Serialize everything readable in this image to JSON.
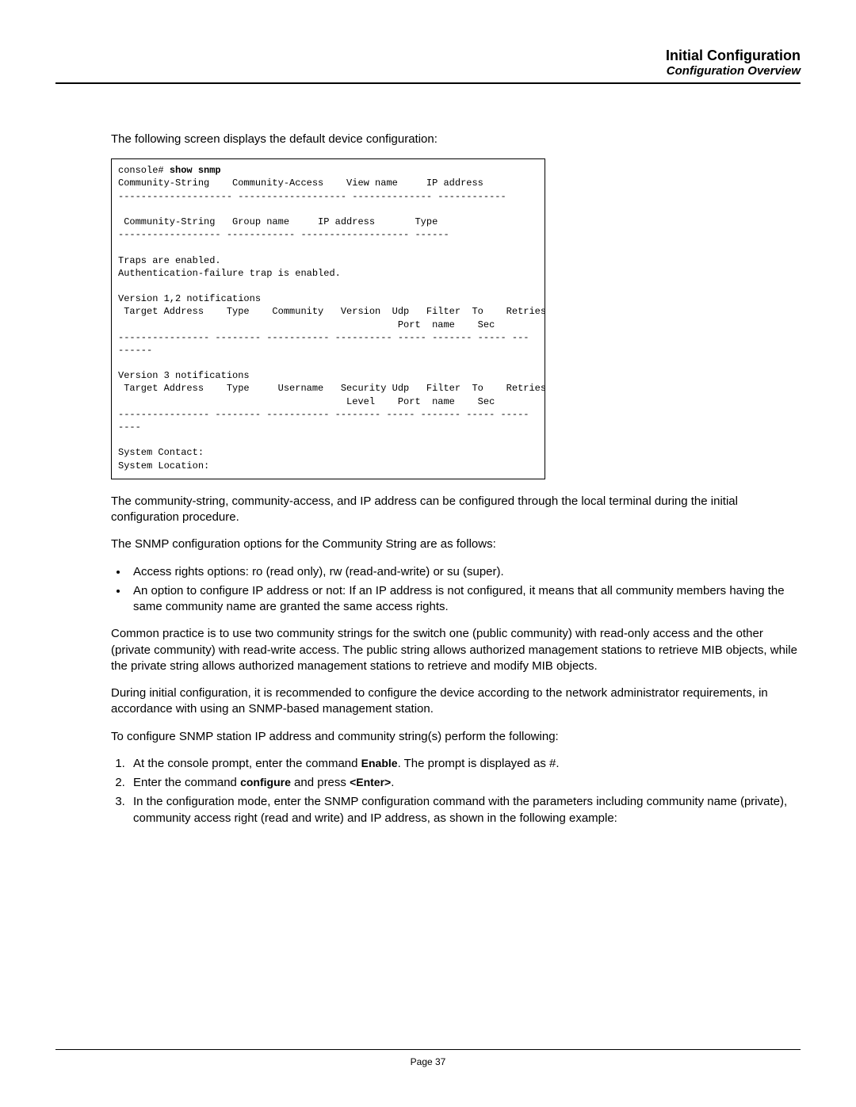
{
  "header": {
    "title": "Initial Configuration",
    "subtitle": "Configuration Overview"
  },
  "intro": "The following screen displays the default device configuration:",
  "terminal": {
    "prompt": "console# ",
    "command": "show snmp",
    "body": "\nCommunity-String    Community-Access    View name     IP address\n-------------------- ------------------- -------------- ------------\n\n Community-String   Group name     IP address       Type\n------------------ ------------ ------------------- ------\n\nTraps are enabled.\nAuthentication-failure trap is enabled.\n\nVersion 1,2 notifications\n Target Address    Type    Community   Version  Udp   Filter  To    Retries\n                                                 Port  name    Sec\n---------------- -------- ----------- ---------- ----- ------- ----- ---\n------\n\nVersion 3 notifications\n Target Address    Type     Username   Security Udp   Filter  To    Retries\n                                        Level    Port  name    Sec\n---------------- -------- ----------- -------- ----- ------- ----- -----\n----\n\nSystem Contact:\nSystem Location:"
  },
  "para1": "The community-string, community-access, and IP address can be configured through the local terminal during the initial configuration procedure.",
  "para2": "The SNMP configuration options for the Community String are as follows:",
  "bullets": [
    "Access rights options: ro (read only), rw (read-and-write) or su (super).",
    "An option to configure IP address or not: If an IP address is not configured, it means that all community members having the same community name are granted the same access rights."
  ],
  "para3": "Common practice is to use two community strings for the switch one (public community) with read-only access and the other (private community) with read-write access. The public string allows authorized management stations to retrieve MIB objects, while the private string allows authorized management stations to retrieve and modify MIB objects.",
  "para4": "During initial configuration, it is recommended to configure the device according to the network administrator requirements, in accordance with using an SNMP-based management station.",
  "para5": "To configure SNMP station IP address and community string(s) perform the following:",
  "steps": {
    "s1a": "At the console prompt, enter the command ",
    "s1b": "Enable",
    "s1c": ". The prompt is displayed as #.",
    "s2a": "Enter the command ",
    "s2b": "configure",
    "s2c": " and press ",
    "s2d": "<Enter>",
    "s2e": ".",
    "s3": "In the configuration mode, enter the SNMP configuration command with the parameters including community name (private), community access right (read and write) and IP address, as shown in the following example:"
  },
  "footer": {
    "page": "Page 37"
  }
}
